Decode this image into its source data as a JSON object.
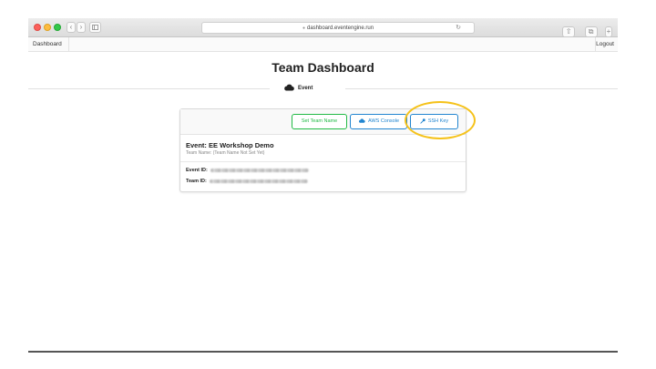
{
  "browser": {
    "url": "dashboard.eventengine.run"
  },
  "nav": {
    "brand": "Dashboard",
    "logout": "Logout"
  },
  "page": {
    "title": "Team Dashboard",
    "section_label": "Event"
  },
  "card": {
    "buttons": {
      "set_team_name": "Set Team Name",
      "aws_console": "AWS Console",
      "ssh_key": "SSH Key"
    },
    "event_name": "Event: EE Workshop Demo",
    "team_name": "Team Name: (Team Name Not Set Yet)",
    "event_id_label": "Event ID:",
    "team_id_label": "Team ID:"
  },
  "colors": {
    "green": "#21ba45",
    "blue": "#2185d0",
    "highlight": "#f5c21a"
  }
}
